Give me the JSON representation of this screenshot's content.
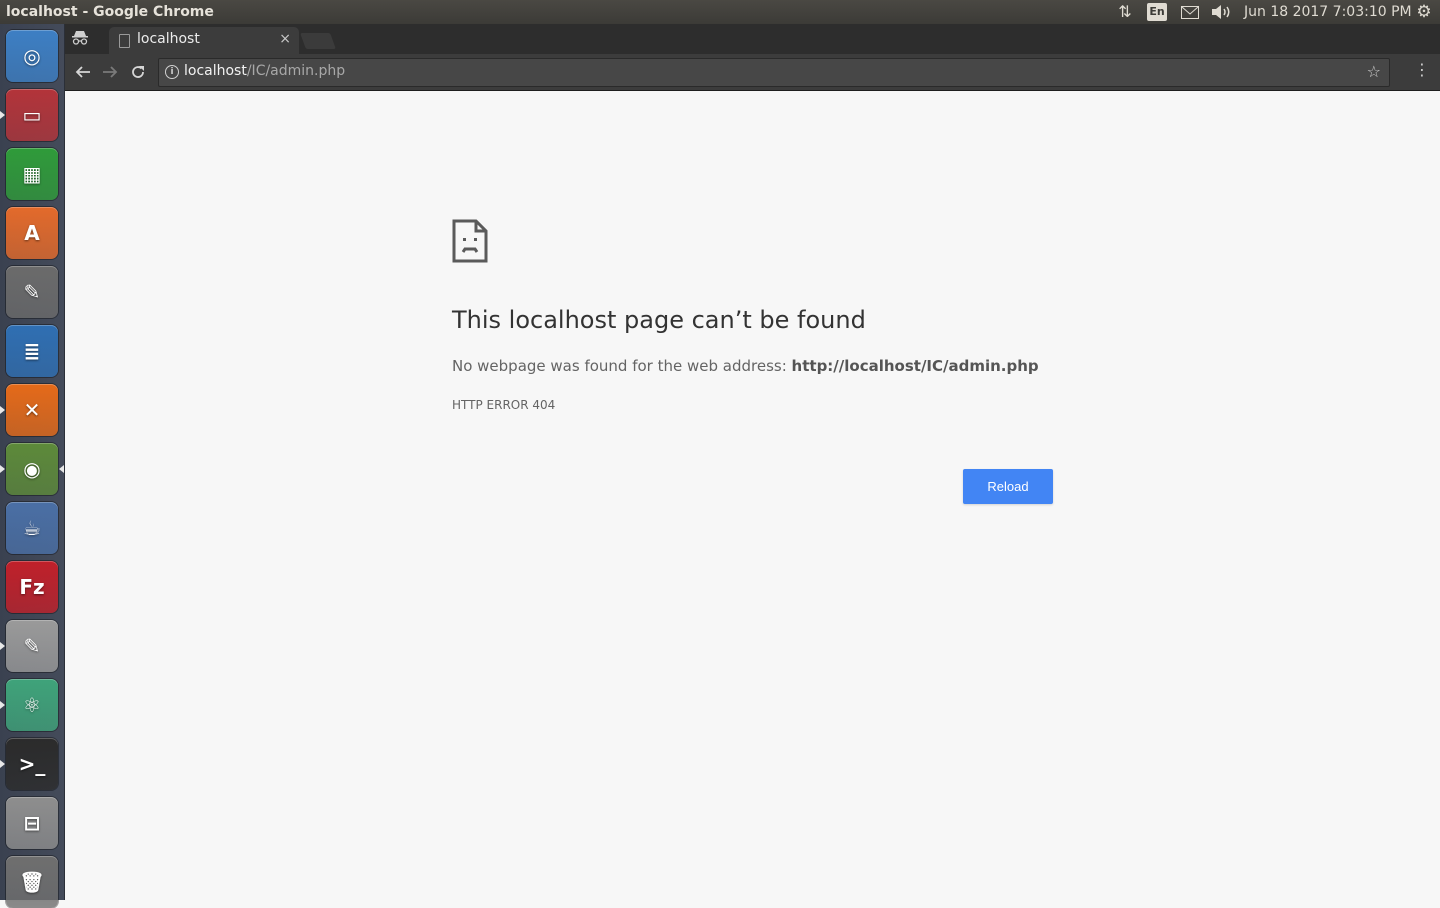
{
  "top_panel": {
    "window_title": "localhost - Google Chrome",
    "language_indicator": "En",
    "clock": "Jun 18 2017  7:03:10 PM",
    "icons": [
      "network-updown-icon",
      "keyboard-language-icon",
      "mail-icon",
      "volume-icon",
      "system-gear-icon"
    ]
  },
  "launcher": {
    "items": [
      {
        "name": "ubuntu-dash",
        "color": "#3d7fc4"
      },
      {
        "name": "files",
        "color": "#b3343a",
        "running": true
      },
      {
        "name": "libreoffice-calc",
        "color": "#2f9b3a"
      },
      {
        "name": "ubuntu-software",
        "color": "#e36a2b"
      },
      {
        "name": "system-settings",
        "color": "#6b6b6b"
      },
      {
        "name": "libreoffice-writer",
        "color": "#2f6fb3"
      },
      {
        "name": "xampp",
        "color": "#e56a19",
        "running": true
      },
      {
        "name": "google-chrome",
        "color": "#5d8a3a",
        "running": true,
        "focused": true
      },
      {
        "name": "genie-teapot",
        "color": "#4a6fa5"
      },
      {
        "name": "filezilla",
        "color": "#c0202a"
      },
      {
        "name": "text-editor",
        "color": "#9a9a9a",
        "running": true
      },
      {
        "name": "atom",
        "color": "#3fa37a",
        "running": true
      },
      {
        "name": "terminal",
        "color": "#2b2b2b",
        "running": true
      },
      {
        "name": "disk-drive",
        "color": "#8e8e8e"
      },
      {
        "name": "trash",
        "color": "#6f6f6f"
      }
    ]
  },
  "browser": {
    "tab": {
      "title": "localhost",
      "close_label": "×"
    },
    "omnibox": {
      "host": "localhost",
      "path": "/IC/admin.php"
    }
  },
  "page": {
    "heading": "This localhost page can’t be found",
    "message_prefix": "No webpage was found for the web address: ",
    "message_url": "http://localhost/IC/admin.php",
    "error_code": "HTTP ERROR 404",
    "reload_label": "Reload",
    "accent_color": "#4285f4"
  }
}
